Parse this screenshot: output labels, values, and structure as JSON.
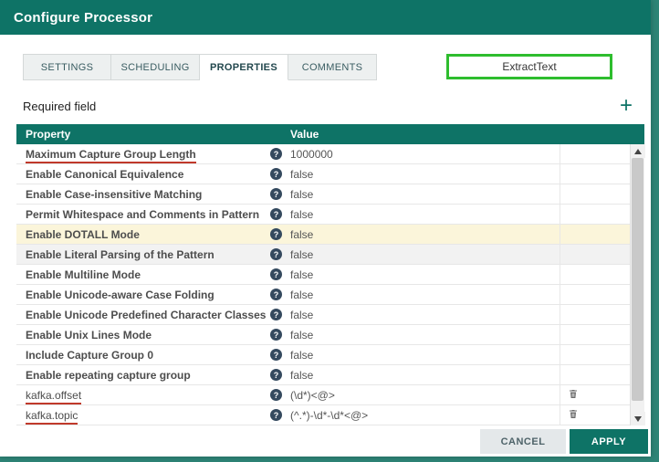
{
  "dialog": {
    "title": "Configure Processor",
    "active_tab": "PROPERTIES",
    "tabs": [
      {
        "label": "SETTINGS"
      },
      {
        "label": "SCHEDULING"
      },
      {
        "label": "PROPERTIES"
      },
      {
        "label": "COMMENTS"
      }
    ]
  },
  "annotation": {
    "label": "ExtractText",
    "box_color": "#2ebd2e",
    "underline_color": "#c0392b"
  },
  "properties_panel": {
    "required_field_label": "Required field",
    "add_property_label": "+"
  },
  "table": {
    "property_header": "Property",
    "value_header": "Value",
    "help_icon_glyph": "?",
    "rows": [
      {
        "property": "Maximum Capture Group Length",
        "value": "1000000",
        "underline": true
      },
      {
        "property": "Enable Canonical Equivalence",
        "value": "false"
      },
      {
        "property": "Enable Case-insensitive Matching",
        "value": "false"
      },
      {
        "property": "Permit Whitespace and Comments in Pattern",
        "value": "false"
      },
      {
        "property": "Enable DOTALL Mode",
        "value": "false",
        "highlight": "cream"
      },
      {
        "property": "Enable Literal Parsing of the Pattern",
        "value": "false",
        "highlight": "gray"
      },
      {
        "property": "Enable Multiline Mode",
        "value": "false"
      },
      {
        "property": "Enable Unicode-aware Case Folding",
        "value": "false"
      },
      {
        "property": "Enable Unicode Predefined Character Classes",
        "value": "false"
      },
      {
        "property": "Enable Unix Lines Mode",
        "value": "false"
      },
      {
        "property": "Include Capture Group 0",
        "value": "false"
      },
      {
        "property": "Enable repeating capture group",
        "value": "false"
      },
      {
        "property": "kafka.offset",
        "value": "(\\d*)<@>",
        "underline": true,
        "deletable": true,
        "dynamic": true
      },
      {
        "property": "kafka.topic",
        "value": "(^.*)-\\d*-\\d*<@>",
        "underline": true,
        "deletable": true,
        "dynamic": true
      }
    ]
  },
  "footer": {
    "cancel_label": "CANCEL",
    "apply_label": "APPLY"
  },
  "colors": {
    "header_teal": "#0e7366",
    "background_teal": "#2d8476",
    "row_highlight_cream": "#fbf5da",
    "row_highlight_gray": "#f2f2f2"
  }
}
